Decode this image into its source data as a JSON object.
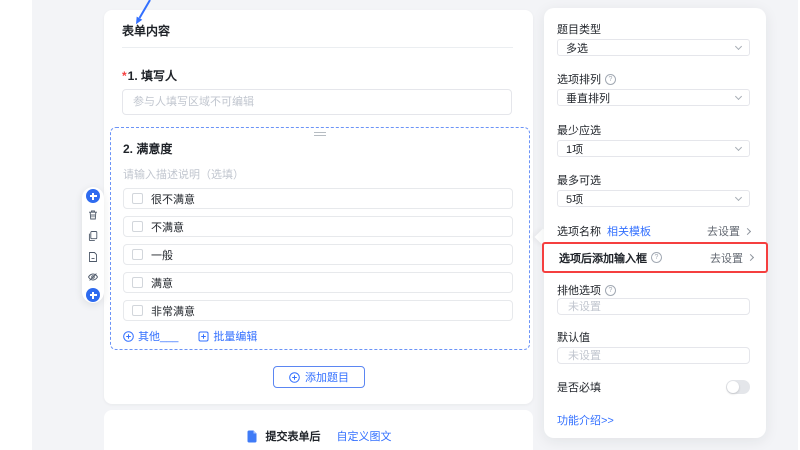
{
  "colors": {
    "accent": "#3370ff",
    "highlight": "#f53f3f",
    "background": "#f3f4f7"
  },
  "icons": {
    "toolbar": [
      "add-above-icon",
      "delete-icon",
      "copy-icon",
      "save-template-icon",
      "hide-icon",
      "add-below-icon"
    ],
    "misc": [
      "question-circle-icon",
      "chevron-down-icon",
      "chevron-right-icon",
      "document-icon",
      "circle-plus-icon",
      "square-plus-icon",
      "drag-handle-icon",
      "annotation-arrow"
    ]
  },
  "canvas": {
    "title": "表单内容",
    "q1": {
      "required_mark": "*",
      "label": "1. 填写人",
      "placeholder": "参与人填写区域不可编辑"
    },
    "q2": {
      "label": "2. 满意度",
      "desc_placeholder": "请输入描述说明（选填）",
      "options": [
        "很不满意",
        "不满意",
        "一般",
        "满意",
        "非常满意"
      ],
      "other_label": "其他___",
      "batch_edit_label": "批量编辑"
    },
    "add_question_label": "添加题目",
    "footer": {
      "submit_after_label": "提交表单后",
      "custom_link_label": "自定义图文"
    }
  },
  "panel": {
    "fields": [
      {
        "label": "题目类型",
        "value": "多选"
      },
      {
        "label": "选项排列",
        "value": "垂直排列"
      },
      {
        "label": "最少应选",
        "value": "1项"
      },
      {
        "label": "最多可选",
        "value": "5项"
      }
    ],
    "option_name": {
      "label": "选项名称",
      "link": "相关模板",
      "action": "去设置"
    },
    "input_after_option": {
      "label": "选项后添加输入框",
      "action": "去设置"
    },
    "exclusive": {
      "label": "排他选项",
      "placeholder": "未设置"
    },
    "default_value": {
      "label": "默认值",
      "placeholder": "未设置"
    },
    "required": {
      "label": "是否必填",
      "enabled": false
    },
    "feature_intro_label": "功能介绍>>"
  }
}
